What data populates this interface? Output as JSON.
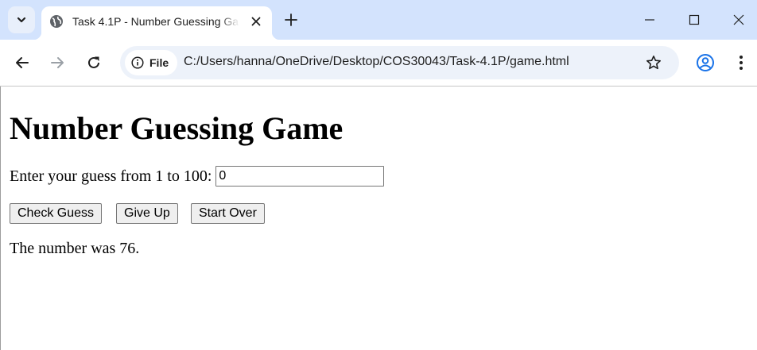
{
  "browser": {
    "tab": {
      "title": "Task 4.1P - Number Guessing Game"
    },
    "address_bar": {
      "chip_label": "File",
      "url": "C:/Users/hanna/OneDrive/Desktop/COS30043/Task-4.1P/game.html"
    },
    "icons": [
      "tab-search-icon",
      "globe-icon",
      "close-icon",
      "plus-icon",
      "minimize-icon",
      "maximize-icon",
      "window-close-icon",
      "back-icon",
      "forward-icon",
      "reload-icon",
      "info-icon",
      "star-icon",
      "profile-icon",
      "kebab-menu-icon"
    ],
    "accent_color": "#1a73e8",
    "tabstrip_color": "#d3e3fd"
  },
  "page": {
    "heading": "Number Guessing Game",
    "guess_prompt": "Enter your guess from 1 to 100:",
    "guess_value": "0",
    "buttons": {
      "check": "Check Guess",
      "give_up": "Give Up",
      "start_over": "Start Over"
    },
    "result": "The number was 76."
  }
}
